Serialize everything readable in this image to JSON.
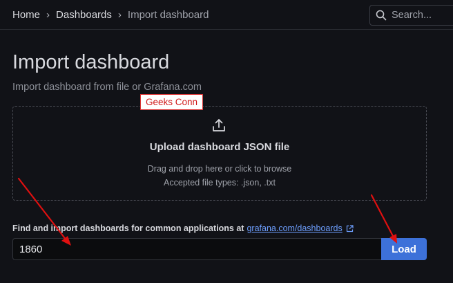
{
  "breadcrumb": {
    "items": [
      "Home",
      "Dashboards",
      "Import dashboard"
    ]
  },
  "search": {
    "placeholder": "Search..."
  },
  "page": {
    "title": "Import dashboard",
    "subtitle": "Import dashboard from file or Grafana.com"
  },
  "upload": {
    "title": "Upload dashboard JSON file",
    "hint": "Drag and drop here or click to browse",
    "accepted": "Accepted file types: .json, .txt",
    "icon": "upload-icon"
  },
  "watermark": {
    "text": "Geeks Conn"
  },
  "grafana_import": {
    "label": "Find and import dashboards for common applications at",
    "link_text": "grafana.com/dashboards",
    "input_value": "1860",
    "button_label": "Load"
  },
  "colors": {
    "background": "#111217",
    "accent": "#3d71d9",
    "link": "#6e9fff",
    "annotation_arrow": "#e01010"
  }
}
